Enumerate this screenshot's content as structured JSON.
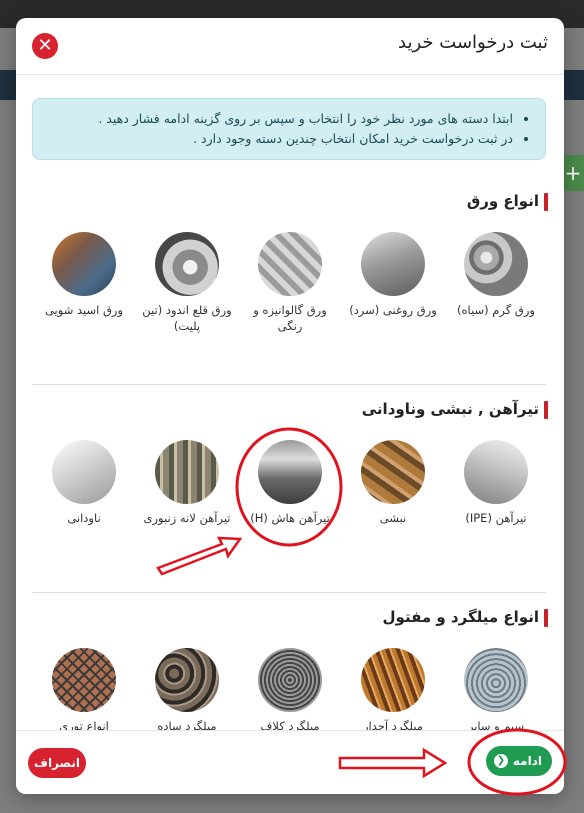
{
  "modal": {
    "title": "ثبت درخواست خرید",
    "close_label": "✕"
  },
  "info": {
    "lines": [
      "ابتدا دسته های مورد نظر خود را انتخاب و سپس بر روی گزینه ادامه فشار دهید .",
      "در ثبت درخواست خرید امکان انتخاب چندین دسته وجود دارد ."
    ]
  },
  "sections": [
    {
      "title": "انواع ورق",
      "items": [
        {
          "label": "ورق گرم (سیاه)",
          "icon": "hot-rolled-sheet-image"
        },
        {
          "label": "ورق روغنی (سرد)",
          "icon": "cold-rolled-sheet-image"
        },
        {
          "label": "ورق گالوانیزه و رنگی",
          "icon": "galvanized-sheet-image"
        },
        {
          "label": "ورق قلع اندود (تین پلیت)",
          "icon": "tin-plate-image"
        },
        {
          "label": "ورق اسید شویی",
          "icon": "pickled-sheet-image"
        }
      ]
    },
    {
      "title": "تیرآهن , نبشی وناودانی",
      "items": [
        {
          "label": "تیرآهن (IPE)",
          "icon": "ipe-beam-image"
        },
        {
          "label": "نبشی",
          "icon": "angle-bar-image"
        },
        {
          "label": "تیرآهن هاش (H)",
          "icon": "h-beam-image"
        },
        {
          "label": "تیرآهن لانه زنبوری",
          "icon": "castellated-beam-image"
        },
        {
          "label": "ناودانی",
          "icon": "channel-bar-image"
        }
      ]
    },
    {
      "title": "انواع میلگرد و مفتول",
      "items": [
        {
          "label": "سیم و سایر",
          "icon": "wire-coil-image"
        },
        {
          "label": "میلگرد آجدار",
          "icon": "ribbed-rebar-image"
        },
        {
          "label": "میلگرد کلاف",
          "icon": "coiled-rebar-image"
        },
        {
          "label": "میلگرد ساده",
          "icon": "plain-rebar-image"
        },
        {
          "label": "انواع توری",
          "icon": "wire-mesh-image"
        }
      ]
    }
  ],
  "footer": {
    "continue_label": "ادامه",
    "cancel_label": "انصراف"
  },
  "colors": {
    "accent_red": "#d6232f",
    "continue_green": "#1f9c52",
    "annotation_red": "#e0141e",
    "info_bg": "#d3eef2"
  }
}
